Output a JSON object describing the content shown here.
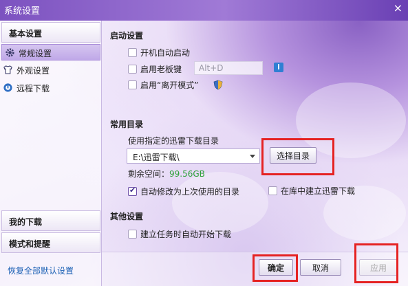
{
  "window": {
    "title": "系统设置"
  },
  "sidebar": {
    "basic_header": "基本设置",
    "items": [
      {
        "label": "常规设置",
        "icon": "gear-icon",
        "active": true
      },
      {
        "label": "外观设置",
        "icon": "shirt-icon",
        "active": false
      },
      {
        "label": "远程下载",
        "icon": "remote-icon",
        "active": false
      }
    ],
    "my_downloads": "我的下载",
    "mode_reminders": "模式和提醒",
    "restore_defaults": "恢复全部默认设置"
  },
  "startup": {
    "title": "启动设置",
    "autostart_label": "开机自动启动",
    "autostart_checked": false,
    "boss_key_label": "启用老板键",
    "boss_key_checked": false,
    "boss_key_value": "Alt+D",
    "away_mode_label": "启用“离开模式”",
    "away_mode_checked": false
  },
  "directory": {
    "title": "常用目录",
    "use_dir_label": "使用指定的迅雷下载目录",
    "path": "E:\\迅雷下载\\",
    "choose_button": "选择目录",
    "free_space_label": "剩余空间：",
    "free_space_value": "99.56GB",
    "auto_modify_label": "自动修改为上次使用的目录",
    "auto_modify_checked": true,
    "create_in_library_label": "在库中建立迅雷下载",
    "create_in_library_checked": false
  },
  "other": {
    "title": "其他设置",
    "auto_start_task_label": "建立任务时自动开始下载",
    "auto_start_task_checked": false
  },
  "footer": {
    "ok": "确定",
    "cancel": "取消",
    "apply": "应用"
  },
  "colors": {
    "accent": "#7c52c0",
    "highlight": "#e52222",
    "free_space": "#2fa23a",
    "link": "#1a5fb4"
  }
}
